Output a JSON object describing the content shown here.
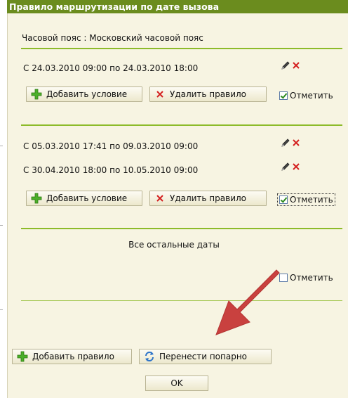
{
  "dialog": {
    "title": "Правило маршрутизации по дате вызова",
    "timezone": "Часовой пояс : Московский часовой пояс"
  },
  "rules": [
    {
      "ranges": [
        "С 24.03.2010 09:00 по 24.03.2010 18:00"
      ],
      "add_condition_label": "Добавить условие",
      "delete_rule_label": "Удалить правило",
      "mark_label": "Отметить",
      "mark_checked": true
    },
    {
      "ranges": [
        "С 05.03.2010 17:41 по 09.03.2010 09:00",
        "С 30.04.2010 18:00 по 10.05.2010 09:00"
      ],
      "add_condition_label": "Добавить условие",
      "delete_rule_label": "Удалить правило",
      "mark_label": "Отметить",
      "mark_checked": true
    }
  ],
  "other_dates": {
    "label": "Все остальные даты",
    "mark_label": "Отметить",
    "mark_checked": false
  },
  "footer": {
    "add_rule_label": "Добавить правило",
    "swap_label": "Перенести попарно",
    "ok_label": "OK"
  },
  "colors": {
    "title_bar": "#6b8c1e",
    "separator": "#8dbb2a",
    "background": "#f7f4e2",
    "annotation_arrow": "#c9413f"
  },
  "icons": {
    "edit": "pencil-icon",
    "delete": "red-x-icon",
    "add": "green-plus-icon",
    "swap": "blue-refresh-icon"
  }
}
